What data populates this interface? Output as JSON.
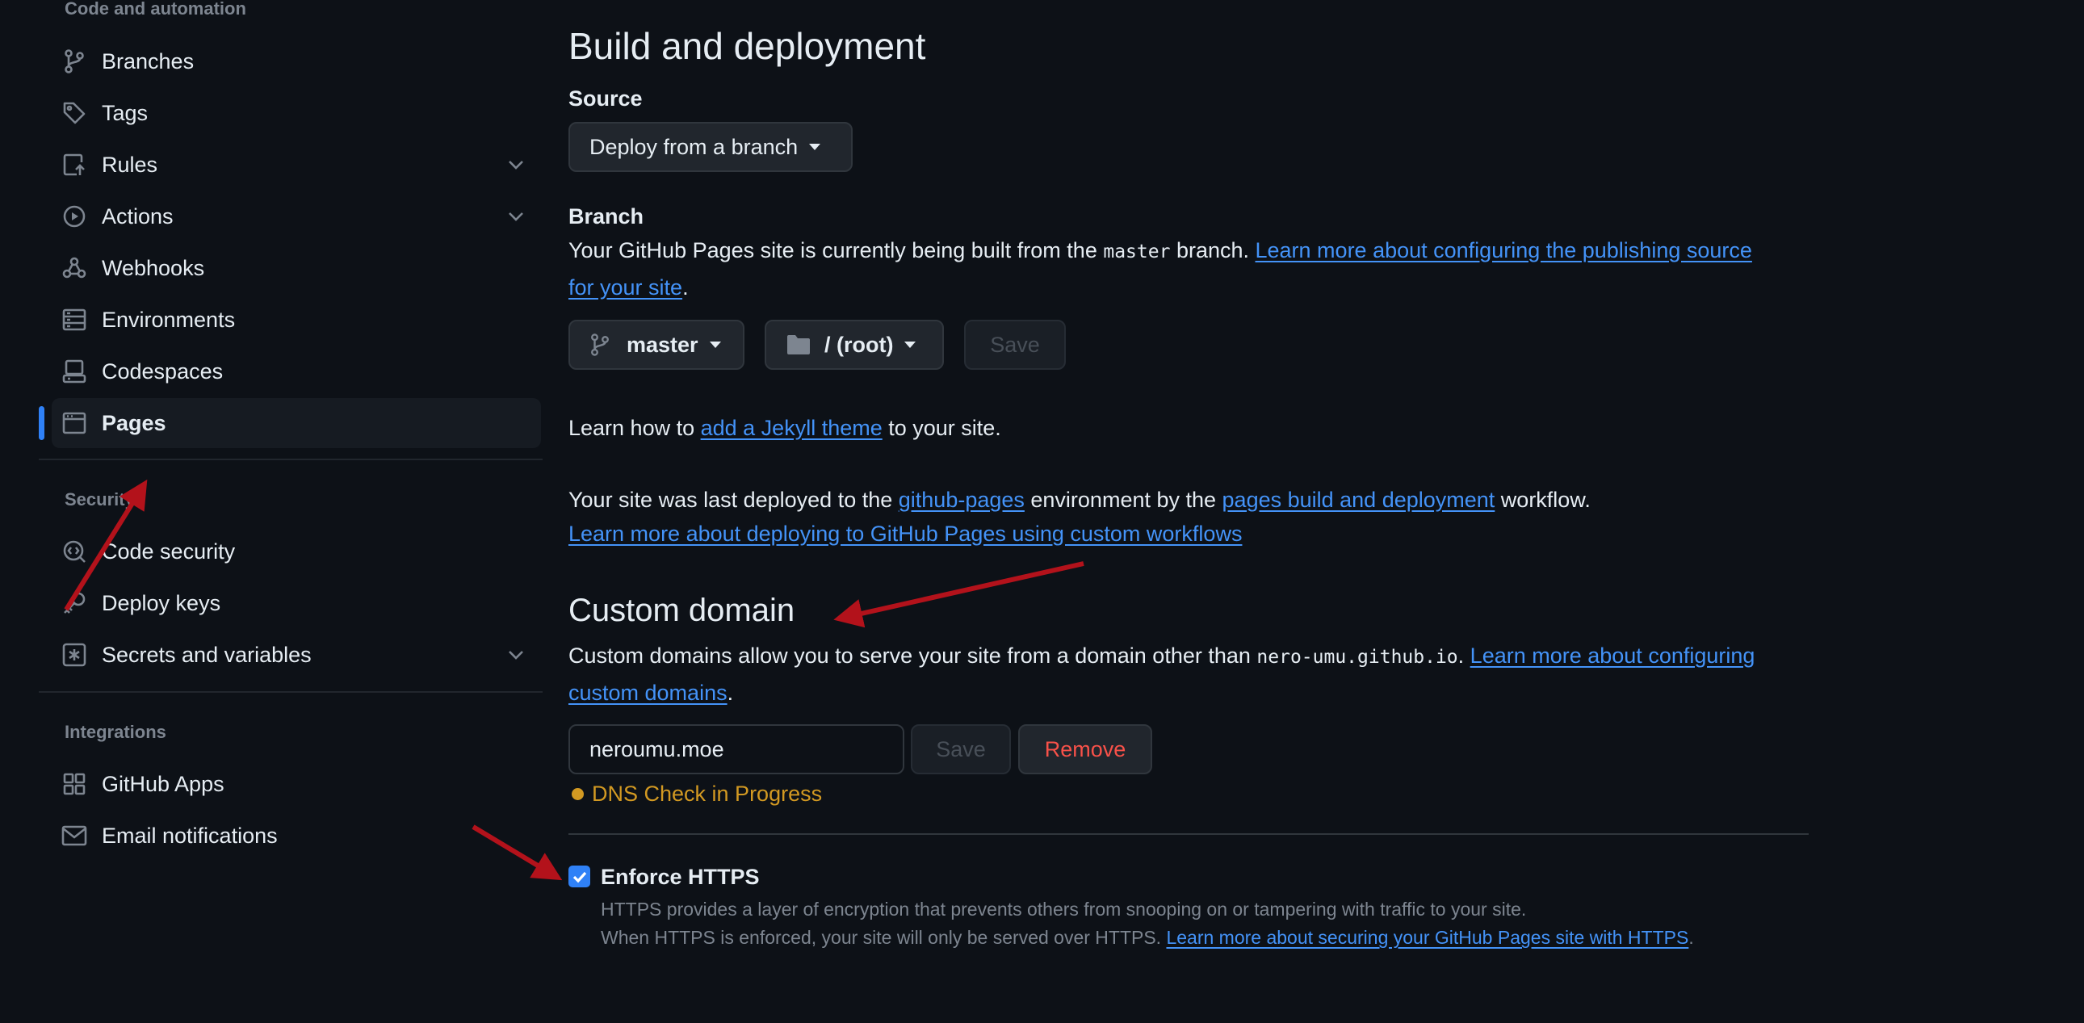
{
  "sidebar": {
    "code_heading": "Code and automation",
    "code_items": [
      {
        "label": "Branches",
        "icon": "branch-icon"
      },
      {
        "label": "Tags",
        "icon": "tag-icon"
      },
      {
        "label": "Rules",
        "icon": "rules-icon",
        "expandable": true
      },
      {
        "label": "Actions",
        "icon": "actions-icon",
        "expandable": true
      },
      {
        "label": "Webhooks",
        "icon": "webhook-icon"
      },
      {
        "label": "Environments",
        "icon": "server-icon"
      },
      {
        "label": "Codespaces",
        "icon": "codespaces-icon"
      },
      {
        "label": "Pages",
        "icon": "browser-icon",
        "active": true
      }
    ],
    "security_heading": "Security",
    "security_items": [
      {
        "label": "Code security",
        "icon": "codescan-icon"
      },
      {
        "label": "Deploy keys",
        "icon": "key-icon"
      },
      {
        "label": "Secrets and variables",
        "icon": "asterisk-icon",
        "expandable": true
      }
    ],
    "integrations_heading": "Integrations",
    "integrations_items": [
      {
        "label": "GitHub Apps",
        "icon": "apps-icon"
      },
      {
        "label": "Email notifications",
        "icon": "mail-icon"
      }
    ]
  },
  "build": {
    "title": "Build and deployment",
    "source_label": "Source",
    "source_value": "Deploy from a branch",
    "branch_label": "Branch",
    "branch_text_1": "Your GitHub Pages site is currently being built from the ",
    "branch_code": "master",
    "branch_text_2": " branch. ",
    "branch_link_line1": "Learn more about configuring the publishing source",
    "branch_link_line2": "for your site",
    "branch_period": ".",
    "branch_select": "master",
    "folder_select": "/ (root)",
    "save_label": "Save",
    "jekyll_text_1": "Learn how to ",
    "jekyll_link": "add a Jekyll theme",
    "jekyll_text_2": " to your site.",
    "deploy_text_1": "Your site was last deployed to the ",
    "deploy_link_env": "github-pages",
    "deploy_text_2": " environment by the ",
    "deploy_link_workflow": "pages build and deployment",
    "deploy_text_3": " workflow.",
    "deploy_link_custom": "Learn more about deploying to GitHub Pages using custom workflows"
  },
  "custom_domain": {
    "title": "Custom domain",
    "desc_text": "Custom domains allow you to serve your site from a domain other than ",
    "desc_code": "nero-umu.github.io",
    "desc_period": ". ",
    "desc_link_line1": "Learn more about configuring",
    "desc_link_line2": "custom domains",
    "desc_end": ".",
    "input_value": "neroumu.moe",
    "save_label": "Save",
    "remove_label": "Remove",
    "dns_status": "DNS Check in Progress",
    "status_color": "#d29922"
  },
  "https": {
    "label": "Enforce HTTPS",
    "checked": true,
    "note_line1": "HTTPS provides a layer of encryption that prevents others from snooping on or tampering with traffic to your site.",
    "note_line2_text": "When HTTPS is enforced, your site will only be served over HTTPS. ",
    "note_line2_link": "Learn more about securing your GitHub Pages site with HTTPS",
    "note_line2_end": "."
  },
  "colors": {
    "accent": "#2f81f7",
    "link": "#4493f8",
    "danger": "#f85149",
    "annotation_arrow": "#b3121b"
  }
}
